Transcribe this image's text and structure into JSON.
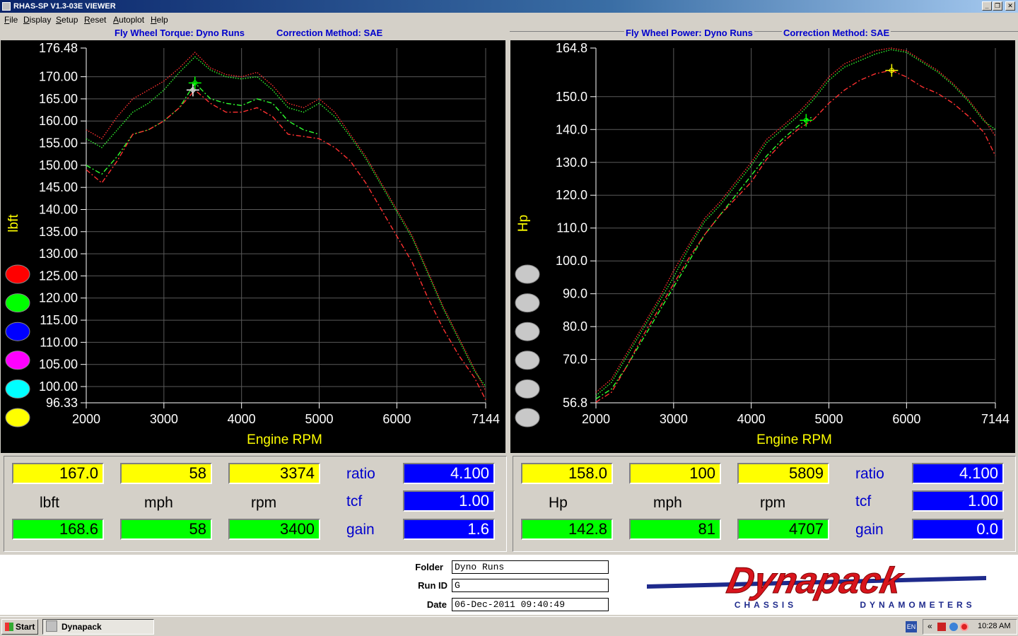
{
  "window": {
    "title": "RHAS-SP V1.3-03E VIEWER"
  },
  "menu": [
    "File",
    "Display",
    "Setup",
    "Reset",
    "Autoplot",
    "Help"
  ],
  "left_header": {
    "title": "Fly Wheel Torque: Dyno Runs",
    "correction": "Correction Method: SAE"
  },
  "right_header": {
    "title": "Fly Wheel Power: Dyno Runs",
    "correction": "Correction Method: SAE"
  },
  "run_buttons_left": [
    "#ff0000",
    "#00ff00",
    "#0000ff",
    "#ff00ff",
    "#00ffff",
    "#ffff00"
  ],
  "run_buttons_right": [
    "#c8c8c8",
    "#c8c8c8",
    "#c8c8c8",
    "#c8c8c8",
    "#c8c8c8",
    "#c8c8c8"
  ],
  "chart_data": [
    {
      "type": "line",
      "title": "",
      "xlabel": "Engine RPM",
      "ylabel": "lbft",
      "xlim": [
        2000,
        7144
      ],
      "ylim": [
        96.33,
        176.48
      ],
      "x_ticks": [
        "2000",
        "3000",
        "4000",
        "5000",
        "6000",
        "7144"
      ],
      "y_ticks": [
        "176.48",
        "170.00",
        "165.00",
        "160.00",
        "155.00",
        "150.00",
        "145.00",
        "140.00",
        "135.00",
        "130.00",
        "125.00",
        "120.00",
        "115.00",
        "110.00",
        "105.00",
        "100.00",
        "96.33"
      ],
      "grid": true,
      "series": [
        {
          "color": "#ff3030",
          "style": "dotted",
          "x": [
            2000,
            2200,
            2400,
            2600,
            2800,
            3000,
            3200,
            3400,
            3600,
            3800,
            4000,
            4200,
            4400,
            4600,
            4800,
            5000,
            5200,
            5400,
            5600,
            5800,
            6000,
            6200,
            6400,
            6600,
            6800,
            7000,
            7144
          ],
          "y": [
            158,
            156,
            161,
            165,
            167,
            169,
            172,
            175.5,
            172,
            170.5,
            170,
            171,
            168,
            164,
            163,
            165,
            162,
            157,
            152,
            146,
            140,
            134,
            126,
            118,
            111,
            104,
            99
          ]
        },
        {
          "color": "#30ff30",
          "style": "dotted",
          "x": [
            2000,
            2200,
            2400,
            2600,
            2800,
            3000,
            3200,
            3400,
            3600,
            3800,
            4000,
            4200,
            4400,
            4600,
            4800,
            5000,
            5200,
            5400,
            5600,
            5800,
            6000,
            6200,
            6400,
            6600,
            6800,
            7000,
            7144
          ],
          "y": [
            156,
            154,
            158,
            162,
            164,
            167,
            171,
            174.5,
            171.5,
            170,
            169.5,
            170,
            167,
            163,
            162,
            164,
            161,
            156.5,
            151.5,
            145.5,
            139.5,
            133.5,
            125.5,
            117.5,
            110.5,
            103.5,
            100
          ]
        },
        {
          "color": "#30ff30",
          "style": "dashdot",
          "x": [
            2000,
            2200,
            2400,
            2600,
            2800,
            3000,
            3200,
            3400,
            3600,
            3800,
            4000,
            4200,
            4400,
            4600,
            4800,
            5000
          ],
          "y": [
            150,
            148,
            152,
            157,
            158,
            160,
            163,
            168.6,
            165,
            164,
            163.5,
            165,
            164,
            160,
            158,
            157
          ]
        },
        {
          "color": "#ff3030",
          "style": "dashdot",
          "x": [
            2000,
            2200,
            2400,
            2600,
            2800,
            3000,
            3200,
            3400,
            3600,
            3800,
            4000,
            4200,
            4400,
            4600,
            4800,
            5000,
            5200,
            5400,
            5600,
            5800,
            6000,
            6200,
            6400,
            6600,
            6800,
            7000,
            7144
          ],
          "y": [
            149,
            146,
            151,
            157,
            158,
            160,
            163,
            167,
            164,
            162,
            162,
            163,
            161,
            157,
            156.5,
            156,
            154,
            151,
            146,
            140,
            134,
            128,
            120,
            113,
            107,
            102,
            97
          ]
        }
      ],
      "cursors": [
        {
          "x": 3374,
          "y": 167.0,
          "color": "#ffffff"
        },
        {
          "x": 3400,
          "y": 168.6,
          "color": "#00ff00"
        }
      ]
    },
    {
      "type": "line",
      "title": "",
      "xlabel": "Engine RPM",
      "ylabel": "Hp",
      "xlim": [
        2000,
        7144
      ],
      "ylim": [
        56.8,
        164.8
      ],
      "x_ticks": [
        "2000",
        "3000",
        "4000",
        "5000",
        "6000",
        "7144"
      ],
      "y_ticks": [
        "164.8",
        "150.0",
        "140.0",
        "130.0",
        "120.0",
        "110.0",
        "100.0",
        "90.0",
        "80.0",
        "70.0",
        "56.8"
      ],
      "grid": true,
      "series": [
        {
          "color": "#ff3030",
          "style": "dotted",
          "x": [
            2000,
            2200,
            2400,
            2600,
            2800,
            3000,
            3200,
            3400,
            3600,
            3800,
            4000,
            4200,
            4400,
            4600,
            4800,
            5000,
            5200,
            5400,
            5600,
            5800,
            6000,
            6200,
            6400,
            6600,
            6800,
            7000,
            7144
          ],
          "y": [
            60,
            64,
            72,
            80,
            88,
            97,
            105,
            113,
            118,
            124,
            130,
            137,
            141,
            145,
            150,
            156,
            160,
            162,
            164,
            164.8,
            164,
            161,
            158,
            154,
            149,
            143,
            138
          ]
        },
        {
          "color": "#30ff30",
          "style": "dotted",
          "x": [
            2000,
            2200,
            2400,
            2600,
            2800,
            3000,
            3200,
            3400,
            3600,
            3800,
            4000,
            4200,
            4400,
            4600,
            4800,
            5000,
            5200,
            5400,
            5600,
            5800,
            6000,
            6200,
            6400,
            6600,
            6800,
            7000,
            7144
          ],
          "y": [
            59,
            63,
            71,
            79,
            87,
            95,
            104,
            112,
            117,
            123,
            129,
            136,
            140,
            144,
            149,
            155,
            159,
            161,
            163,
            164.3,
            163.5,
            160.5,
            157.5,
            153.5,
            148.5,
            142.5,
            140
          ]
        },
        {
          "color": "#30ff30",
          "style": "dashdot",
          "x": [
            2000,
            2200,
            2400,
            2600,
            2800,
            3000,
            3200,
            3400,
            3600,
            3800,
            4000,
            4200,
            4400,
            4600,
            4700,
            4800
          ],
          "y": [
            58,
            61,
            68,
            76,
            84,
            92,
            100,
            108,
            114,
            120,
            126,
            132,
            137,
            141,
            142.8,
            144
          ]
        },
        {
          "color": "#ff3030",
          "style": "dashdot",
          "x": [
            2000,
            2200,
            2400,
            2600,
            2800,
            3000,
            3200,
            3400,
            3600,
            3800,
            4000,
            4200,
            4400,
            4600,
            4800,
            5000,
            5200,
            5400,
            5600,
            5800,
            6000,
            6200,
            6400,
            6600,
            6800,
            7000,
            7144
          ],
          "y": [
            57,
            60,
            68,
            77,
            85,
            93,
            101,
            108,
            114,
            119,
            124,
            131,
            136,
            140,
            143,
            148,
            152,
            155,
            157,
            158,
            156,
            153,
            151,
            148,
            144,
            139,
            132
          ]
        }
      ],
      "cursors": [
        {
          "x": 5809,
          "y": 158.0,
          "color": "#ffff00"
        },
        {
          "x": 4707,
          "y": 142.8,
          "color": "#00ff00"
        }
      ]
    }
  ],
  "left_readout": {
    "row1": [
      "167.0",
      "58",
      "3374"
    ],
    "units": [
      "lbft",
      "mph",
      "rpm"
    ],
    "row2": [
      "168.6",
      "58",
      "3400"
    ],
    "labels": [
      "ratio",
      "tcf",
      "gain"
    ],
    "values": [
      "4.100",
      "1.00",
      "1.6"
    ]
  },
  "right_readout": {
    "row1": [
      "158.0",
      "100",
      "5809"
    ],
    "units": [
      "Hp",
      "mph",
      "rpm"
    ],
    "row2": [
      "142.8",
      "81",
      "4707"
    ],
    "labels": [
      "ratio",
      "tcf",
      "gain"
    ],
    "values": [
      "4.100",
      "1.00",
      "0.0"
    ]
  },
  "info": {
    "folder_label": "Folder",
    "folder": "Dyno Runs",
    "runid_label": "Run ID",
    "runid": "G",
    "date_label": "Date",
    "date": "06-Dec-2011  09:40:49"
  },
  "logo": {
    "brand": "Dynapack",
    "tagline_left": "CHASSIS",
    "tagline_right": "DYNAMOMETERS"
  },
  "taskbar": {
    "start": "Start",
    "task": "Dynapack",
    "lang": "EN",
    "clock": "10:28 AM"
  }
}
